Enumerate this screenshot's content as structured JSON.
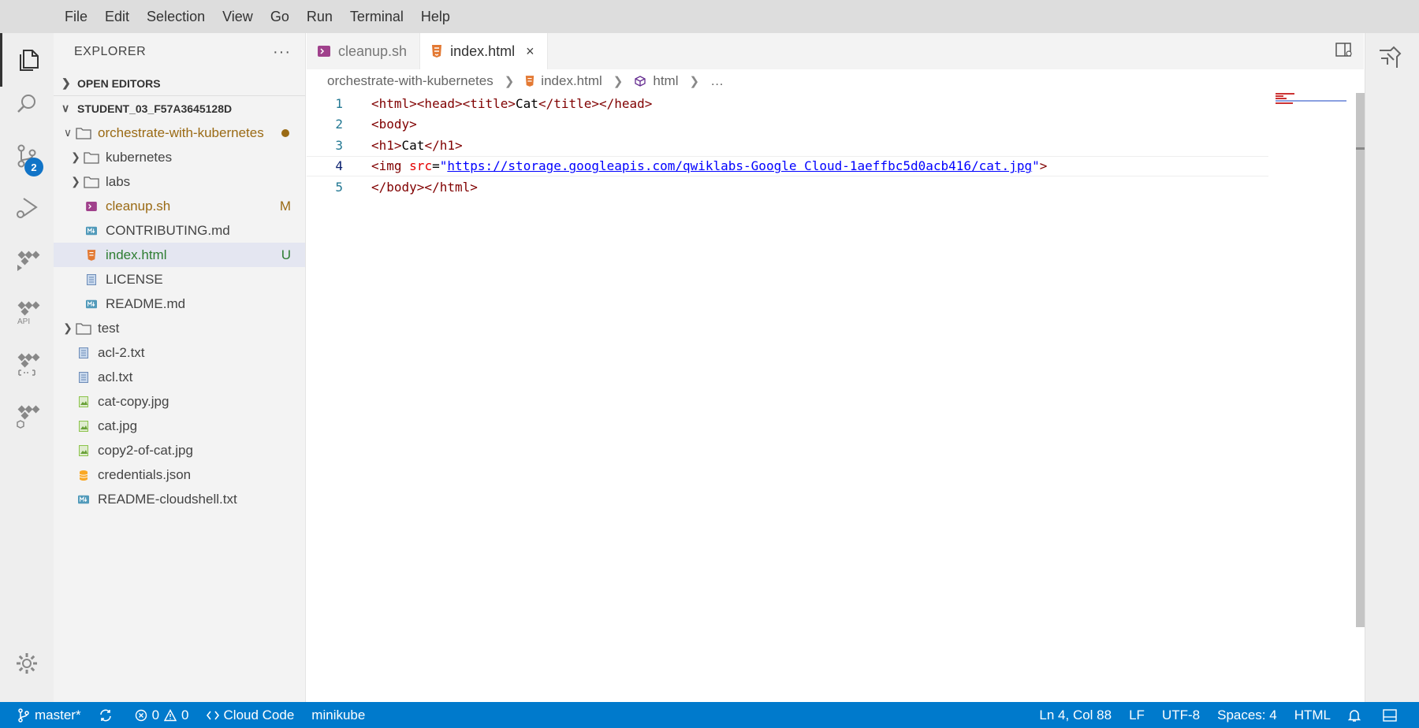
{
  "menu": [
    "File",
    "Edit",
    "Selection",
    "View",
    "Go",
    "Run",
    "Terminal",
    "Help"
  ],
  "activity": {
    "scm_badge": "2",
    "api_label": "API"
  },
  "explorer": {
    "title": "EXPLORER",
    "more": "···",
    "open_editors": "OPEN EDITORS",
    "workspace": "STUDENT_03_F57A3645128D",
    "tree": [
      {
        "label": "orchestrate-with-kubernetes",
        "type": "folder",
        "expanded": true,
        "depth": 0,
        "status": "dot"
      },
      {
        "label": "kubernetes",
        "type": "folder",
        "expanded": false,
        "depth": 1
      },
      {
        "label": "labs",
        "type": "folder",
        "expanded": false,
        "depth": 1
      },
      {
        "label": "cleanup.sh",
        "type": "shell",
        "depth": 1,
        "decor": "M"
      },
      {
        "label": "CONTRIBUTING.md",
        "type": "markdown",
        "depth": 1
      },
      {
        "label": "index.html",
        "type": "html",
        "depth": 1,
        "decor": "U",
        "selected": true
      },
      {
        "label": "LICENSE",
        "type": "text",
        "depth": 1
      },
      {
        "label": "README.md",
        "type": "markdown",
        "depth": 1
      },
      {
        "label": "test",
        "type": "folder",
        "expanded": false,
        "depth": 0
      },
      {
        "label": "acl-2.txt",
        "type": "text",
        "depth": 0
      },
      {
        "label": "acl.txt",
        "type": "text",
        "depth": 0
      },
      {
        "label": "cat-copy.jpg",
        "type": "image",
        "depth": 0
      },
      {
        "label": "cat.jpg",
        "type": "image",
        "depth": 0
      },
      {
        "label": "copy2-of-cat.jpg",
        "type": "image",
        "depth": 0
      },
      {
        "label": "credentials.json",
        "type": "json",
        "depth": 0
      },
      {
        "label": "README-cloudshell.txt",
        "type": "markdown",
        "depth": 0
      }
    ]
  },
  "tabs": [
    {
      "label": "cleanup.sh",
      "active": false
    },
    {
      "label": "index.html",
      "active": true,
      "close": "×"
    }
  ],
  "breadcrumb": {
    "folder": "orchestrate-with-kubernetes",
    "file": "index.html",
    "symbol": "html",
    "ellipsis": "…"
  },
  "editor": {
    "current_line": 4,
    "lines": [
      {
        "n": "1",
        "parts": [
          [
            "tag",
            "<html><head><title>"
          ],
          [
            "txt",
            "Cat"
          ],
          [
            "tag",
            "</title></head>"
          ]
        ]
      },
      {
        "n": "2",
        "parts": [
          [
            "tag",
            "<body>"
          ]
        ]
      },
      {
        "n": "3",
        "parts": [
          [
            "tag",
            "<h1>"
          ],
          [
            "txt",
            "Cat"
          ],
          [
            "tag",
            "</h1>"
          ]
        ]
      },
      {
        "n": "4",
        "parts": [
          [
            "tag",
            "<img "
          ],
          [
            "attr",
            "src"
          ],
          [
            "txt",
            "="
          ],
          [
            "str",
            "\""
          ],
          [
            "link",
            "https://storage.googleapis.com/qwiklabs-Google Cloud-1aeffbc5d0acb416/cat.jpg"
          ],
          [
            "str",
            "\""
          ],
          [
            "tag",
            ">"
          ]
        ]
      },
      {
        "n": "5",
        "parts": [
          [
            "tag",
            "</body></html>"
          ]
        ]
      }
    ]
  },
  "status": {
    "branch": "master*",
    "errors": "0",
    "warnings": "0",
    "cloud_code": "Cloud Code",
    "cluster": "minikube",
    "position": "Ln 4, Col 88",
    "eol": "LF",
    "encoding": "UTF-8",
    "indent": "Spaces: 4",
    "language": "HTML"
  },
  "colors": {
    "accent": "#007acc",
    "modified": "#9a6a14",
    "untracked": "#2e7d32"
  }
}
